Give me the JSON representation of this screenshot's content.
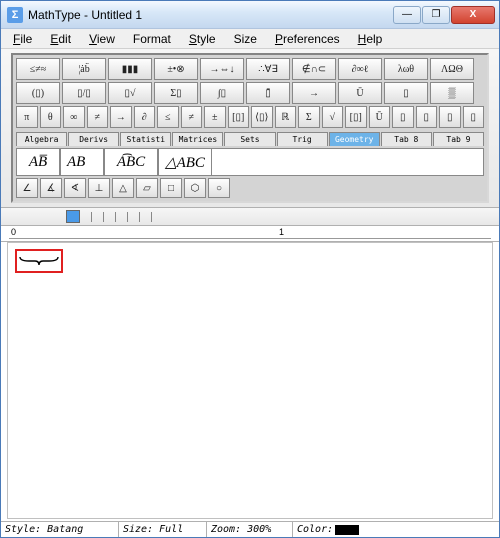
{
  "title": "MathType - Untitled 1",
  "app_icon_glyph": "Σ",
  "win_buttons": {
    "min": "—",
    "max": "❐",
    "close": "X"
  },
  "menu": [
    {
      "ul": "F",
      "rest": "ile"
    },
    {
      "ul": "E",
      "rest": "dit"
    },
    {
      "ul": "V",
      "rest": "iew"
    },
    {
      "ul": "",
      "rest": "Format"
    },
    {
      "ul": "S",
      "rest": "tyle"
    },
    {
      "ul": "",
      "rest": "Size"
    },
    {
      "ul": "P",
      "rest": "references"
    },
    {
      "ul": "H",
      "rest": "elp"
    }
  ],
  "row1": [
    "≤≠≈",
    "¦ȧb̈",
    "▮▮▮",
    "±•⊗",
    "→⇔↓",
    "∴∀∃",
    "∉∩⊂",
    "∂∞ℓ",
    "λωθ",
    "ΛΩΘ"
  ],
  "row2": [
    "(▯)",
    "▯/▯",
    "▯√",
    "Σ▯",
    "∫▯",
    "▯̄",
    "→",
    "Ū",
    "▯",
    "▒"
  ],
  "row3": [
    "π",
    "θ",
    "∞",
    "≠",
    "→",
    "∂",
    "≤",
    "≠",
    "±",
    "[▯]",
    "⟨▯⟩",
    "ℝ",
    "Σ",
    "√",
    "[▯]",
    "Ū",
    "▯",
    "▯",
    "▯",
    "▯"
  ],
  "tabs": [
    {
      "label": "Algebra",
      "active": false
    },
    {
      "label": "Derivs",
      "active": false
    },
    {
      "label": "Statisti",
      "active": false
    },
    {
      "label": "Matrices",
      "active": false
    },
    {
      "label": "Sets",
      "active": false
    },
    {
      "label": "Trig",
      "active": false
    },
    {
      "label": "Geometry",
      "active": true
    },
    {
      "label": "Tab 8",
      "active": false
    },
    {
      "label": "Tab 9",
      "active": false
    }
  ],
  "gallery": [
    {
      "text": "AB̅",
      "w": 44
    },
    {
      "text": "AB⃗",
      "w": 44
    },
    {
      "text": "A͡BC",
      "w": 54
    },
    {
      "text": "△ABC",
      "w": 54
    }
  ],
  "small_row": [
    "∠",
    "∡",
    "∢",
    "⊥",
    "△",
    "▱",
    "□",
    "⬡",
    "○"
  ],
  "ruler": {
    "m0": "0",
    "m1": "1"
  },
  "status": {
    "style_label": "Style:",
    "style_value": "Batang",
    "size_label": "Size:",
    "size_value": "Full",
    "zoom_label": "Zoom:",
    "zoom_value": "300%",
    "color_label": "Color:"
  }
}
